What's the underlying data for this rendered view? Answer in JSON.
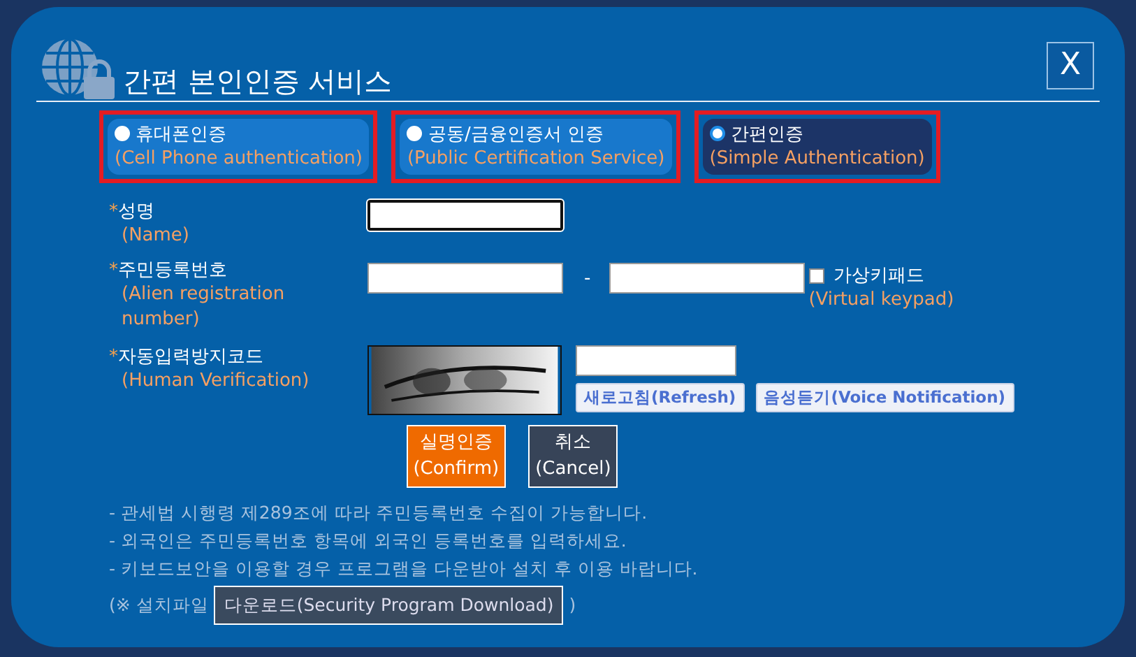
{
  "dialog": {
    "title": "간편 본인인증 서비스",
    "close": "X"
  },
  "tabs": [
    {
      "label": "휴대폰인증",
      "sublabel": "(Cell Phone authentication)",
      "selected": false
    },
    {
      "label": "공동/금융인증서 인증",
      "sublabel": "(Public Certification Service)",
      "selected": false
    },
    {
      "label": "간편인증",
      "sublabel": "(Simple Authentication)",
      "selected": true
    }
  ],
  "name_row": {
    "mark": "*",
    "label": "성명",
    "sublabel": "(Name)",
    "focused": true
  },
  "id_row": {
    "mark": "*",
    "label": "주민등록번호",
    "sublabel": "(Alien registration number)",
    "separator": "-",
    "keypad": {
      "label": "가상키패드",
      "sublabel": "(Virtual keypad)",
      "checked": false
    }
  },
  "captcha_row": {
    "mark": "*",
    "label": "자동입력방지코드",
    "sublabel": "(Human Verification)",
    "image": {
      "kind": "picture"
    },
    "buttons": [
      "새로고침(Refresh)",
      "음성듣기(Voice Notification)"
    ]
  },
  "actions": [
    {
      "kind": "confirm",
      "label": "실명인증",
      "sublabel": "(Confirm)"
    },
    {
      "kind": "cancel",
      "label": "취소",
      "sublabel": "(Cancel)"
    }
  ],
  "notes": [
    "- 관세법 시행령 제289조에 따라 주민등록번호 수집이 가능합니다.",
    "- 외국인은 주민등록번호 항목에 외국인 등록번호를 입력하세요.",
    "- 키보드보안을 이용할 경우 프로그램을 다운받아 설치 후 이용 바랍니다."
  ],
  "download": {
    "prefix": "(※ 설치파일",
    "button": "다운로드(Security Program Download)",
    "suffix": ")"
  }
}
